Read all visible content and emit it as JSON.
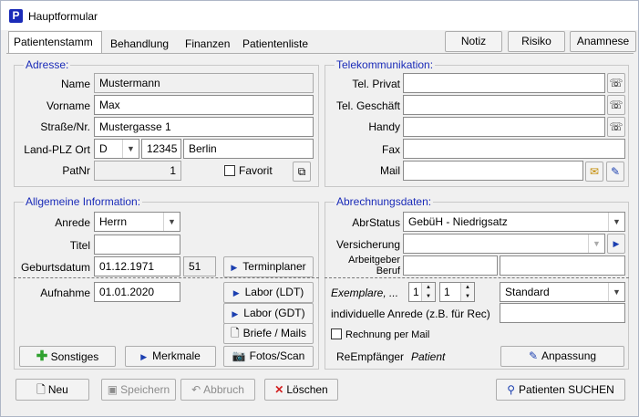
{
  "window": {
    "title": "Hauptformular",
    "app_icon_letter": "P"
  },
  "tabs": [
    "Patientenstamm",
    "Behandlung",
    "Finanzen",
    "Patientenliste"
  ],
  "top_buttons": {
    "notiz": "Notiz",
    "risiko": "Risiko",
    "anamnese": "Anamnese"
  },
  "adresse": {
    "legend": "Adresse:",
    "name_label": "Name",
    "name": "Mustermann",
    "vorname_label": "Vorname",
    "vorname": "Max",
    "strasse_label": "Straße/Nr.",
    "strasse": "Mustergasse 1",
    "land_label": "Land-PLZ Ort",
    "land": "D",
    "plz": "12345",
    "ort": "Berlin",
    "patnr_label": "PatNr",
    "patnr": "1",
    "favorit_label": "Favorit"
  },
  "telekommunikation": {
    "legend": "Telekommunikation:",
    "privat_label": "Tel. Privat",
    "privat": "",
    "geschaeft_label": "Tel. Geschäft",
    "geschaeft": "",
    "handy_label": "Handy",
    "handy": "",
    "fax_label": "Fax",
    "fax": "",
    "mail_label": "Mail",
    "mail": ""
  },
  "allgemein": {
    "legend": "Allgemeine Information:",
    "anrede_label": "Anrede",
    "anrede": "Herrn",
    "titel_label": "Titel",
    "titel": "",
    "geburtsdatum_label": "Geburtsdatum",
    "geburtsdatum": "01.12.1971",
    "alter": "51",
    "terminplaner_label": "Terminplaner",
    "aufnahme_label": "Aufnahme",
    "aufnahme": "01.01.2020",
    "labor_ldt_label": "Labor (LDT)",
    "labor_gdt_label": "Labor (GDT)",
    "briefe_label": "Briefe / Mails",
    "sonstiges_label": "Sonstiges",
    "merkmale_label": "Merkmale",
    "fotos_label": "Fotos/Scan"
  },
  "abrechnung": {
    "legend": "Abrechnungsdaten:",
    "abrstatus_label": "AbrStatus",
    "abrstatus": "GebüH - Niedrigsatz",
    "versicherung_label": "Versicherung",
    "versicherung": "",
    "arbeitgeber_label": "Arbeitgeber",
    "beruf_label": "Beruf",
    "arbeitgeber": "",
    "beruf": "",
    "exemplare_label": "Exemplare, ...",
    "exemplare1": "1",
    "exemplare2": "1",
    "format": "Standard",
    "ind_anrede_label": "individuelle Anrede (z.B. für Rec)",
    "ind_anrede": "",
    "rechnung_mail_label": "Rechnung per Mail",
    "reempfaenger_label": "ReEmpfänger",
    "reempfaenger": "Patient",
    "anpassung_label": "Anpassung"
  },
  "bottom_buttons": {
    "neu": "Neu",
    "speichern": "Speichern",
    "abbruch": "Abbruch",
    "loeschen": "Löschen",
    "suchen": "Patienten SUCHEN"
  },
  "colors": {
    "legend": "#1a2bb8",
    "accent": "#1b3fb0",
    "app_icon": "#1a2bb8"
  }
}
